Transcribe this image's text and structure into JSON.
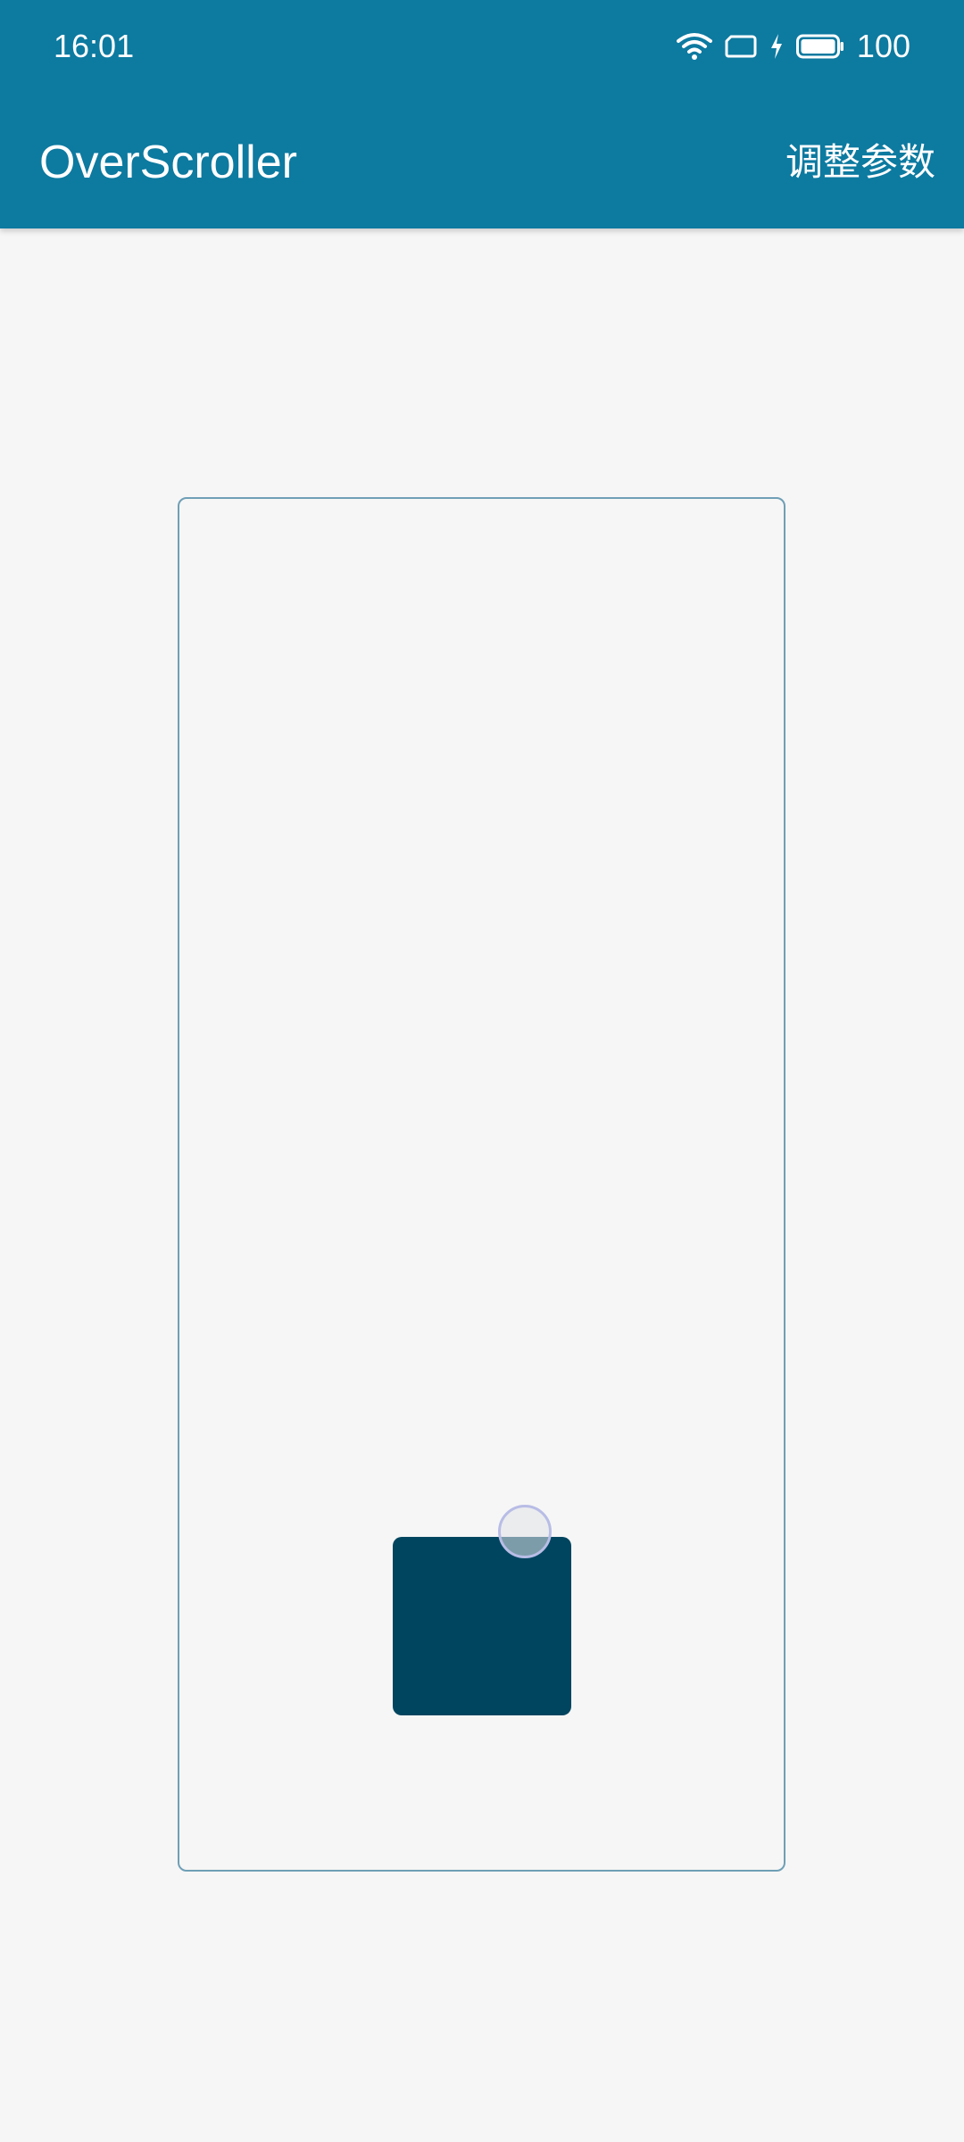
{
  "status_bar": {
    "time": "16:01",
    "battery_level": "100",
    "icons": [
      "wifi-icon",
      "cast-icon",
      "charging-icon",
      "battery-icon"
    ]
  },
  "app_bar": {
    "title": "OverScroller",
    "action_label": "调整参数",
    "color": "#0d7aa0"
  },
  "content": {
    "background_color": "#f6f6f6",
    "frame_border_color": "#6f9fb6",
    "block_color": "#00455f",
    "touch_indicator_color": "#b8bde6"
  }
}
